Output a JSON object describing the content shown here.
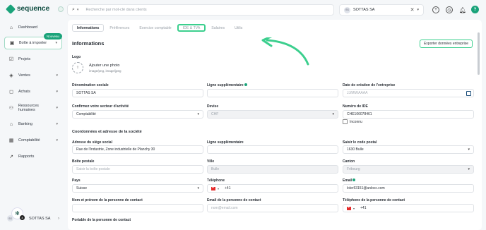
{
  "header": {
    "logo": "sequence",
    "search_placeholder": "Recherche par mot-clé dans clients",
    "company_initials": "SS",
    "company_name": "SOTTAS SA",
    "help": "?"
  },
  "sidebar": {
    "items": [
      {
        "label": "Dashboard",
        "icon": "home-icon"
      },
      {
        "label": "Boîte à importer",
        "icon": "inbox-icon"
      },
      {
        "label": "Projets",
        "icon": "check-icon"
      },
      {
        "label": "Ventes",
        "icon": "tag-icon"
      },
      {
        "label": "Achats",
        "icon": "bag-icon"
      },
      {
        "label": "Ressources humaines",
        "icon": "people-icon"
      },
      {
        "label": "Banking",
        "icon": "bank-icon"
      },
      {
        "label": "Comptabilité",
        "icon": "calculator-icon"
      },
      {
        "label": "Rapports",
        "icon": "chart-icon"
      }
    ],
    "new_badge": "Nouveau",
    "footer_company": "SOTTAS SA",
    "footer_badge": "4"
  },
  "tabs": [
    "Informations",
    "Préférences",
    "Exercice comptable",
    "IDE & TVA",
    "Salaires",
    "Utilis"
  ],
  "main": {
    "title": "Informations",
    "export_label": "Exporter données entreprise",
    "logo_label": "Logo",
    "upload_title": "Ajouter une photo",
    "upload_hint": "image/png, image/jpeg",
    "fields": {
      "denomination": {
        "label": "Dénomination sociale",
        "value": "SOTTAS SA"
      },
      "ligne_sup1": {
        "label": "Ligne supplémentaire",
        "value": ""
      },
      "date_creation": {
        "label": "Date de création de l'entreprise",
        "placeholder": "JJ/MM/AAAA"
      },
      "secteur": {
        "label": "Confirmez votre secteur d'activité",
        "value": "Comptabilité"
      },
      "devise": {
        "label": "Devise",
        "value": "CHF"
      },
      "ide": {
        "label": "Numéro de IDE",
        "value": "CHE106078461"
      },
      "inconnu": "Inconnu"
    },
    "coords_title": "Coordonnées et adresse de la société",
    "address": {
      "siege": {
        "label": "Adresse du siège social",
        "value": "Rue de l'Industrie, Zone industrielle de Planchy 30"
      },
      "ligne_sup2": {
        "label": "Ligne supplémentaire",
        "value": ""
      },
      "code_postal": {
        "label": "Saisir le code postal",
        "value": "1630 Bulle"
      },
      "boite": {
        "label": "Boîte postale",
        "placeholder": "Saisir la boîte postale"
      },
      "ville": {
        "label": "Ville",
        "value": "Bulle"
      },
      "canton": {
        "label": "Canton",
        "value": "Fribourg"
      },
      "pays": {
        "label": "Pays",
        "value": "Suisse"
      },
      "telephone": {
        "label": "Téléphone",
        "value": "+41"
      },
      "email": {
        "label": "Email",
        "value": "loler53151@anlocc.com"
      },
      "contact_nom": {
        "label": "Nom et prénom de la personne de contact",
        "value": ""
      },
      "contact_email": {
        "label": "Email de la personne de contact",
        "placeholder": "nom@email.com"
      },
      "contact_tel": {
        "label": "Téléphone de la personne de contact",
        "value": "+41"
      },
      "contact_portable": {
        "label": "Portable de la personne de contact"
      }
    }
  }
}
